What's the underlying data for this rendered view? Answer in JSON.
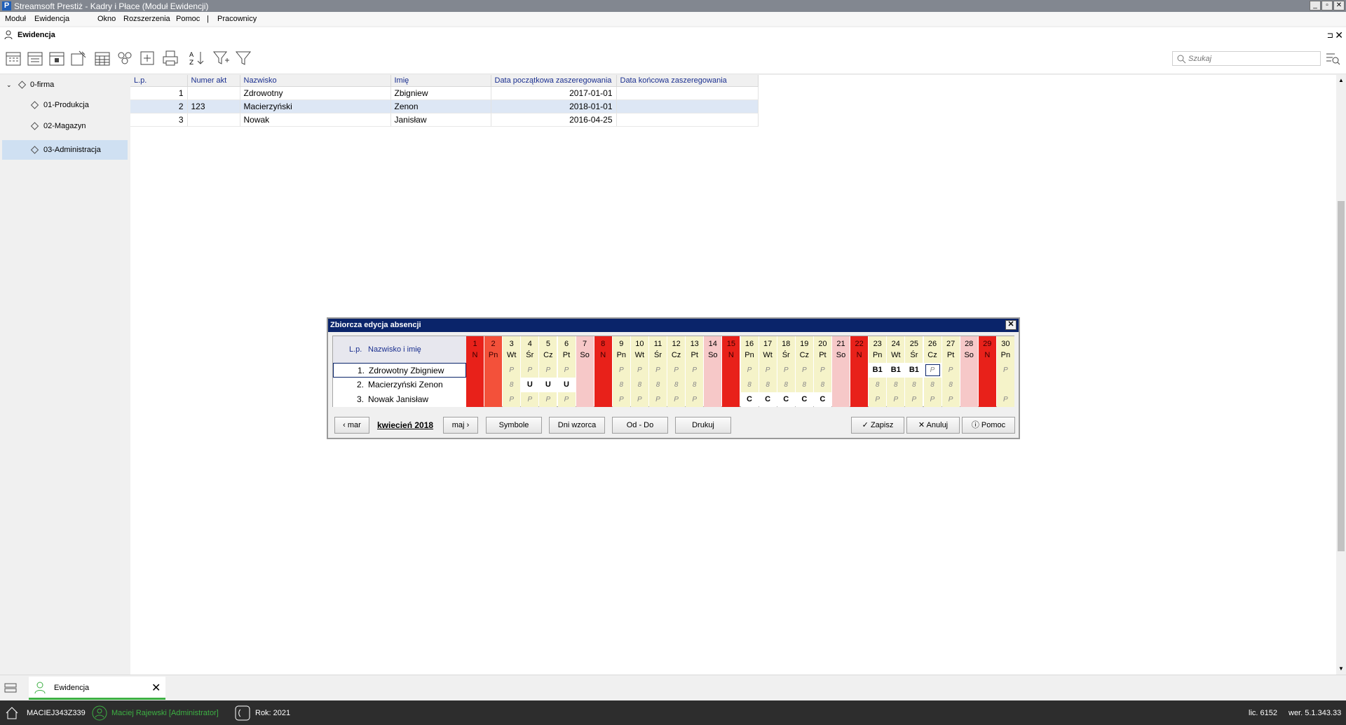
{
  "window": {
    "title": "Streamsoft Prestiż - Kadry i Płace (Moduł Ewidencji)",
    "logo": "P"
  },
  "menu": [
    "Moduł",
    "Ewidencja",
    "Okno",
    "Rozszerzenia",
    "Pomoc",
    "|",
    "Pracownicy"
  ],
  "doc": {
    "title": "Ewidencja",
    "pin": "⊐",
    "close": "✕"
  },
  "search": {
    "placeholder": "Szukaj"
  },
  "tree": [
    {
      "label": "0-firma"
    },
    {
      "label": "01-Produkcja"
    },
    {
      "label": "02-Magazyn"
    },
    {
      "label": "03-Administracja"
    }
  ],
  "employees": {
    "columns": [
      "L.p.",
      "Numer akt",
      "Nazwisko",
      "Imię",
      "Data początkowa zaszeregowania",
      "Data końcowa zaszeregowania"
    ],
    "rows": [
      {
        "lp": "1",
        "akt": "",
        "nazwisko": "Zdrowotny",
        "imie": "Zbigniew",
        "od": "2017-01-01",
        "do": ""
      },
      {
        "lp": "2",
        "akt": "123",
        "nazwisko": "Macierzyński",
        "imie": "Zenon",
        "od": "2018-01-01",
        "do": ""
      },
      {
        "lp": "3",
        "akt": "",
        "nazwisko": "Nowak",
        "imie": "Janisław",
        "od": "2016-04-25",
        "do": ""
      }
    ]
  },
  "dialog": {
    "title": "Zbiorcza edycja absencji",
    "close": "✕",
    "header_lp": "L.p.",
    "header_name": "Nazwisko i imię",
    "days": [
      {
        "n": "1",
        "d": "N",
        "t": "red"
      },
      {
        "n": "2",
        "d": "Pn",
        "t": "orange"
      },
      {
        "n": "3",
        "d": "Wt",
        "t": "w"
      },
      {
        "n": "4",
        "d": "Śr",
        "t": "w"
      },
      {
        "n": "5",
        "d": "Cz",
        "t": "w"
      },
      {
        "n": "6",
        "d": "Pt",
        "t": "w"
      },
      {
        "n": "7",
        "d": "So",
        "t": "pink"
      },
      {
        "n": "8",
        "d": "N",
        "t": "red"
      },
      {
        "n": "9",
        "d": "Pn",
        "t": "w"
      },
      {
        "n": "10",
        "d": "Wt",
        "t": "w"
      },
      {
        "n": "11",
        "d": "Śr",
        "t": "w"
      },
      {
        "n": "12",
        "d": "Cz",
        "t": "w"
      },
      {
        "n": "13",
        "d": "Pt",
        "t": "w"
      },
      {
        "n": "14",
        "d": "So",
        "t": "pink"
      },
      {
        "n": "15",
        "d": "N",
        "t": "red"
      },
      {
        "n": "16",
        "d": "Pn",
        "t": "w"
      },
      {
        "n": "17",
        "d": "Wt",
        "t": "w"
      },
      {
        "n": "18",
        "d": "Śr",
        "t": "w"
      },
      {
        "n": "19",
        "d": "Cz",
        "t": "w"
      },
      {
        "n": "20",
        "d": "Pt",
        "t": "w"
      },
      {
        "n": "21",
        "d": "So",
        "t": "pink"
      },
      {
        "n": "22",
        "d": "N",
        "t": "red"
      },
      {
        "n": "23",
        "d": "Pn",
        "t": "w"
      },
      {
        "n": "24",
        "d": "Wt",
        "t": "w"
      },
      {
        "n": "25",
        "d": "Śr",
        "t": "w"
      },
      {
        "n": "26",
        "d": "Cz",
        "t": "w"
      },
      {
        "n": "27",
        "d": "Pt",
        "t": "w"
      },
      {
        "n": "28",
        "d": "So",
        "t": "pink"
      },
      {
        "n": "29",
        "d": "N",
        "t": "red"
      },
      {
        "n": "30",
        "d": "Pn",
        "t": "w"
      }
    ],
    "rows": [
      {
        "lp": "1.",
        "name": "Zdrowotny Zbigniew",
        "cells": [
          "",
          "",
          "P",
          "P",
          "P",
          "P",
          "",
          "",
          "P",
          "P",
          "P",
          "P",
          "P",
          "",
          "",
          "P",
          "P",
          "P",
          "P",
          "P",
          "",
          "",
          "B1",
          "B1",
          "B1",
          "P",
          "P",
          "",
          "",
          "P"
        ]
      },
      {
        "lp": "2.",
        "name": "Macierzyński Zenon",
        "cells": [
          "",
          "",
          "8",
          "U",
          "U",
          "U",
          "",
          "",
          "8",
          "8",
          "8",
          "8",
          "8",
          "",
          "",
          "8",
          "8",
          "8",
          "8",
          "8",
          "",
          "",
          "8",
          "8",
          "8",
          "8",
          "8",
          "",
          "",
          ""
        ]
      },
      {
        "lp": "3.",
        "name": "Nowak Janisław",
        "cells": [
          "",
          "",
          "P",
          "P",
          "P",
          "P",
          "",
          "",
          "P",
          "P",
          "P",
          "P",
          "P",
          "",
          "",
          "C",
          "C",
          "C",
          "C",
          "C",
          "",
          "",
          "P",
          "P",
          "P",
          "P",
          "P",
          "",
          "",
          "P"
        ]
      }
    ],
    "buttons": {
      "prev_month": "mar",
      "month": "kwiecień 2018",
      "next_month": "maj",
      "symbole": "Symbole",
      "dni_wzorca": "Dni wzorca",
      "od_do": "Od - Do",
      "drukuj": "Drukuj",
      "zapisz": "Zapisz",
      "anuluj": "Anuluj",
      "pomoc": "Pomoc"
    }
  },
  "taskbar": {
    "tab_label": "Ewidencja",
    "tab_close": "✕"
  },
  "status": {
    "host": "MACIEJ343Z339",
    "user": "Maciej Rajewski [Administrator]",
    "year": "Rok: 2021",
    "license": "lic. 6152",
    "version": "wer. 5.1.343.33"
  },
  "colors": {
    "red": "#e8211a",
    "orange": "#f3513a",
    "pink": "#f6c8c8",
    "workday_bg": "#f5f3c9",
    "title_bg": "#0a246a",
    "accent_green": "#3db043"
  }
}
